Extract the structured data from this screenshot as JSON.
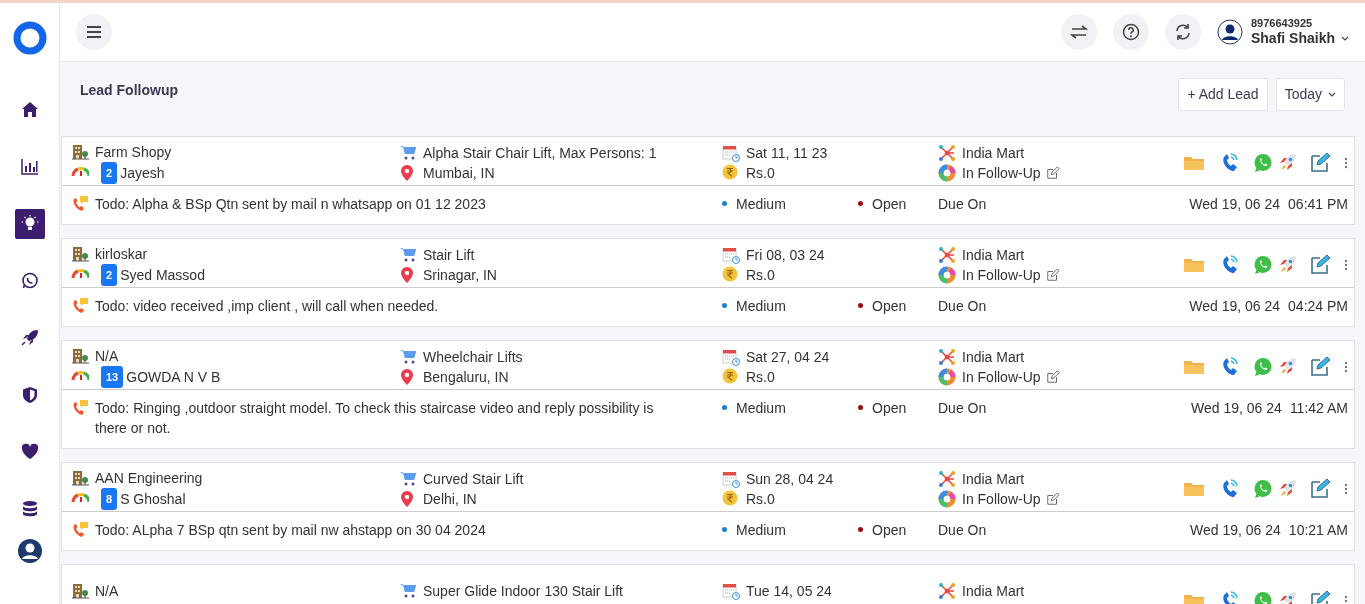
{
  "sidebar": {
    "items": [
      {
        "selected": false
      },
      {
        "selected": false
      },
      {
        "selected": true
      },
      {
        "selected": false
      },
      {
        "selected": false
      },
      {
        "selected": false
      },
      {
        "selected": false
      },
      {
        "selected": false
      }
    ]
  },
  "user": {
    "phone": "8976643925",
    "name": "Shafi Shaikh"
  },
  "page": {
    "title": "Lead Followup",
    "add_button": "+ Add Lead",
    "filter": "Today"
  },
  "leads": [
    {
      "company": "Farm Shopy",
      "product": "Alpha Stair Chair Lift, Max Persons: 1",
      "date": "Sat 11, 11 23",
      "source": "India Mart",
      "count": "2",
      "contact": "Jayesh",
      "location": "Mumbai, IN",
      "amount": "Rs.0",
      "stage": "In Follow-Up",
      "todo": "Todo: Alpha & BSp Qtn sent by mail n whatsapp on 01 12 2023",
      "priority": {
        "label": "Medium",
        "color": "#1a7fd4"
      },
      "status": {
        "label": "Open",
        "color": "#9b0d0d"
      },
      "due_label": "Due On",
      "due_date": "Wed 19, 06 24",
      "due_time": "06:41 PM"
    },
    {
      "company": "kirloskar",
      "product": "Stair Lift",
      "date": "Fri 08, 03 24",
      "source": "India Mart",
      "count": "2",
      "contact": "Syed Massod",
      "location": "Srinagar, IN",
      "amount": "Rs.0",
      "stage": "In Follow-Up",
      "todo": "Todo: video received ,imp client , will call when needed.",
      "priority": {
        "label": "Medium",
        "color": "#1a7fd4"
      },
      "status": {
        "label": "Open",
        "color": "#9b0d0d"
      },
      "due_label": "Due On",
      "due_date": "Wed 19, 06 24",
      "due_time": "04:24 PM"
    },
    {
      "company": "N/A",
      "product": "Wheelchair Lifts",
      "date": "Sat 27, 04 24",
      "source": "India Mart",
      "count": "13",
      "contact": "GOWDA N V B",
      "location": "Bengaluru, IN",
      "amount": "Rs.0",
      "stage": "In Follow-Up",
      "todo": "Todo: Ringing ,outdoor straight model. To check this staircase video and reply possibility is there or not.",
      "priority": {
        "label": "Medium",
        "color": "#1a7fd4"
      },
      "status": {
        "label": "Open",
        "color": "#9b0d0d"
      },
      "due_label": "Due On",
      "due_date": "Wed 19, 06 24",
      "due_time": "11:42 AM"
    },
    {
      "company": "AAN Engineering",
      "product": "Curved Stair Lift",
      "date": "Sun 28, 04 24",
      "source": "India Mart",
      "count": "8",
      "contact": "S Ghoshal",
      "location": "Delhi, IN",
      "amount": "Rs.0",
      "stage": "In Follow-Up",
      "todo": "Todo: ALpha 7 BSp qtn sent by mail nw ahstapp on 30 04 2024",
      "priority": {
        "label": "Medium",
        "color": "#1a7fd4"
      },
      "status": {
        "label": "Open",
        "color": "#9b0d0d"
      },
      "due_label": "Due On",
      "due_date": "Wed 19, 06 24",
      "due_time": "10:21 AM"
    },
    {
      "company": "N/A",
      "product": "Super Glide Indoor 130 Stair Lift",
      "date": "Tue 14, 05 24",
      "source": "India Mart"
    }
  ]
}
